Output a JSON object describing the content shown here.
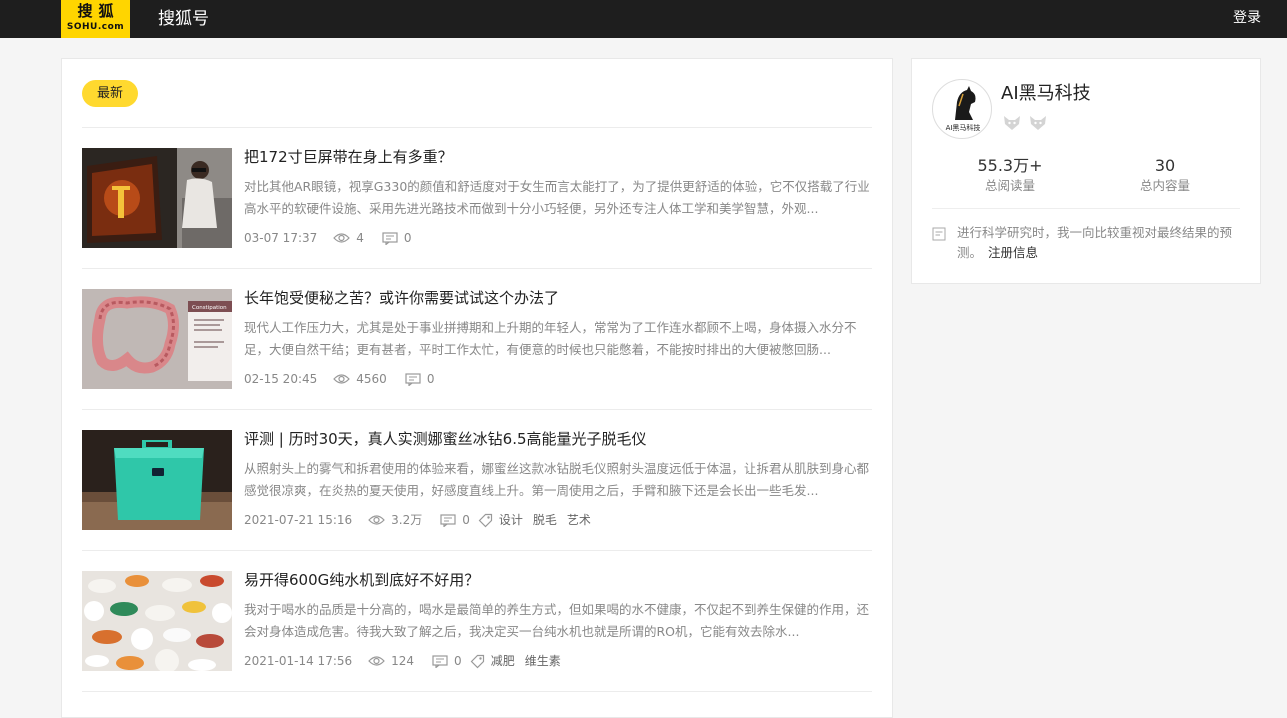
{
  "header": {
    "logo_main": "搜狐",
    "logo_sub": "SOHU.com",
    "site_name": "搜狐号",
    "login_label": "登录"
  },
  "feed": {
    "active_tab": "最新",
    "articles": [
      {
        "title": "把172寸巨屏带在身上有多重？",
        "summary": "对比其他AR眼镜，视享G330的颜值和舒适度对于女生而言太能打了，为了提供更舒适的体验，它不仅搭载了行业高水平的软硬件设施、采用先进光路技术而做到十分小巧轻便，另外还专注人体工学和美学智慧，外观...",
        "time": "03-07 17:37",
        "views": "4",
        "comments": "0",
        "tags": [],
        "thumb_icon": "ar-glasses-image"
      },
      {
        "title": "长年饱受便秘之苦？或许你需要试试这个办法了",
        "summary": "现代人工作压力大，尤其是处于事业拼搏期和上升期的年轻人，常常为了工作连水都顾不上喝，身体摄入水分不足，大便自然干结；更有甚者，平时工作太忙，有便意的时候也只能憋着，不能按时排出的大便被憋回肠...",
        "time": "02-15 20:45",
        "views": "4560",
        "comments": "0",
        "tags": [],
        "thumb_icon": "colon-illustration-image",
        "thumb_caption": "Constipation"
      },
      {
        "title": "评测 | 历时30天，真人实测娜蜜丝冰钻6.5高能量光子脱毛仪",
        "summary": "从照射头上的雾气和拆君使用的体验来看，娜蜜丝这款冰钻脱毛仪照射头温度远低于体温，让拆君从肌肤到身心都感觉很凉爽，在炎热的夏天使用，好感度直线上升。第一周使用之后，手臂和腋下还是会长出一些毛发...",
        "time": "2021-07-21 15:16",
        "views": "3.2万",
        "comments": "0",
        "tags": [
          "设计",
          "脱毛",
          "艺术"
        ],
        "thumb_icon": "teal-box-image"
      },
      {
        "title": "易开得600G纯水机到底好不好用？",
        "summary": "我对于喝水的品质是十分高的，喝水是最简单的养生方式，但如果喝的水不健康，不仅起不到养生保健的作用，还会对身体造成危害。待我大致了解之后，我决定买一台纯水机也就是所谓的RO机，它能有效去除水...",
        "time": "2021-01-14 17:56",
        "views": "124",
        "comments": "0",
        "tags": [
          "减肥",
          "维生素"
        ],
        "thumb_icon": "pills-image"
      }
    ]
  },
  "author": {
    "name": "AI黑马科技",
    "avatar_text": "AI黑马科技",
    "stats": [
      {
        "value": "55.3万+",
        "label": "总阅读量"
      },
      {
        "value": "30",
        "label": "总内容量"
      }
    ],
    "description": "进行科学研究时，我一向比较重视对最终结果的预测。",
    "register_link": "注册信息"
  },
  "colors": {
    "brand_yellow": "#ffd500",
    "topbar": "#1e1e1e",
    "pill": "#ffd92f"
  }
}
